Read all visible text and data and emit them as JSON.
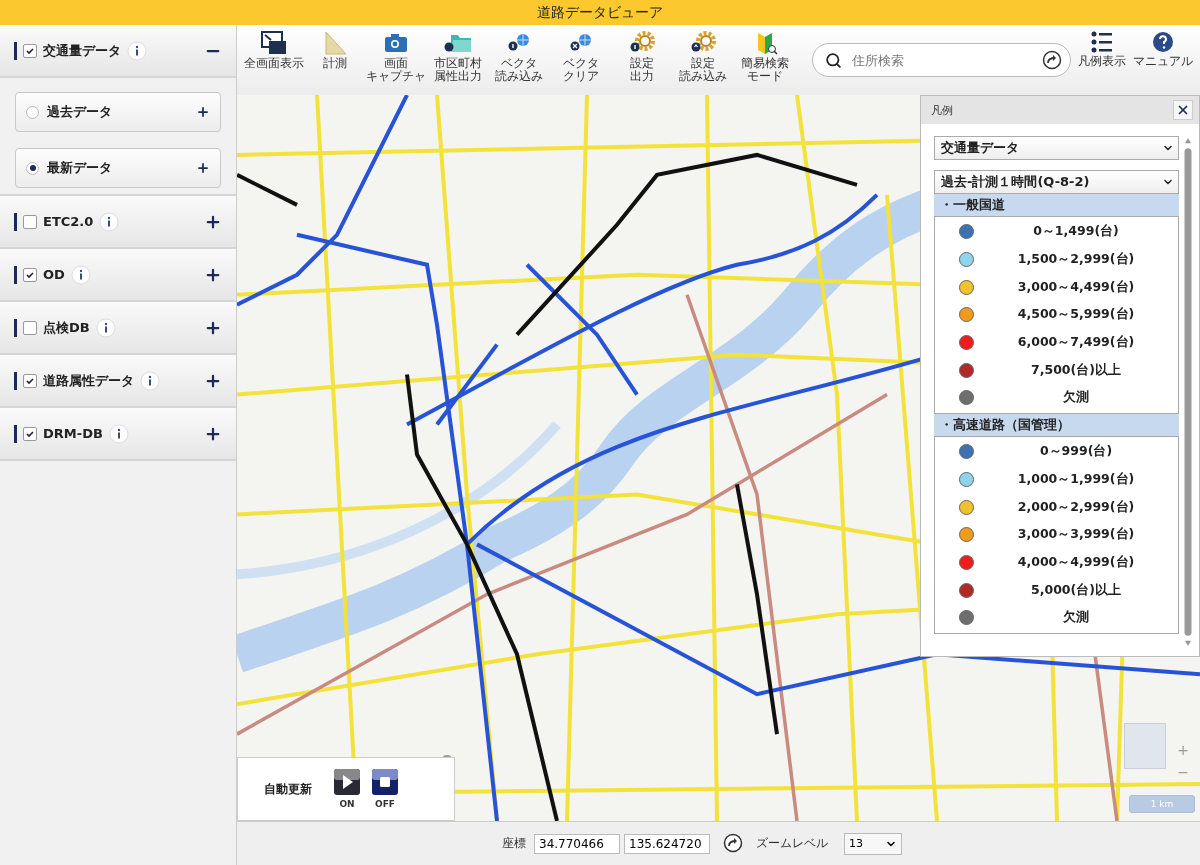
{
  "window": {
    "title": "道路データビューア"
  },
  "sidebar": {
    "layers": [
      {
        "label": "交通量データ",
        "checked": true,
        "expanded": true,
        "children": [
          {
            "label": "過去データ",
            "selected": false
          },
          {
            "label": "最新データ",
            "selected": true
          }
        ]
      },
      {
        "label": "ETC2.0",
        "checked": false,
        "expanded": false
      },
      {
        "label": "OD",
        "checked": true,
        "expanded": false
      },
      {
        "label": "点検DB",
        "checked": false,
        "expanded": false
      },
      {
        "label": "道路属性データ",
        "checked": true,
        "expanded": false
      },
      {
        "label": "DRM-DB",
        "checked": true,
        "expanded": false
      }
    ]
  },
  "toolbar": {
    "tools": [
      {
        "kind": "fullscreen",
        "lines": [
          "全画面表示"
        ]
      },
      {
        "kind": "ruler",
        "lines": [
          "計測"
        ]
      },
      {
        "kind": "camera",
        "lines": [
          "画面",
          "キャプチャ"
        ]
      },
      {
        "kind": "folder",
        "lines": [
          "市区町村",
          "属性出力"
        ]
      },
      {
        "kind": "vector-load",
        "lines": [
          "ベクタ",
          "読み込み"
        ]
      },
      {
        "kind": "vector-clear",
        "lines": [
          "ベクタ",
          "クリア"
        ]
      },
      {
        "kind": "gear-out",
        "lines": [
          "設定",
          "出力"
        ]
      },
      {
        "kind": "gear-in",
        "lines": [
          "設定",
          "読み込み"
        ]
      },
      {
        "kind": "beginner",
        "lines": [
          "簡易検索",
          "モード"
        ]
      }
    ],
    "search": {
      "placeholder": "住所検索"
    },
    "right_tools": [
      {
        "kind": "list",
        "label": "凡例表示"
      },
      {
        "kind": "help",
        "label": "マニュアル"
      }
    ]
  },
  "legend": {
    "title": "凡例",
    "selects": [
      "交通量データ",
      "過去-計測１時間(Q-8-2)"
    ],
    "groups": [
      {
        "title": "・一般国道",
        "items": [
          {
            "label": "0～1,499(台)",
            "color": "#3b72b4"
          },
          {
            "label": "1,500～2,999(台)",
            "color": "#8ed4ea"
          },
          {
            "label": "3,000～4,499(台)",
            "color": "#f2c22c"
          },
          {
            "label": "4,500～5,999(台)",
            "color": "#f09a1e"
          },
          {
            "label": "6,000～7,499(台)",
            "color": "#f01c1c"
          },
          {
            "label": "7,500(台)以上",
            "color": "#b02828"
          },
          {
            "label": "欠測",
            "color": "#6e6e6e"
          }
        ]
      },
      {
        "title": "・高速道路（国管理）",
        "items": [
          {
            "label": "0～999(台)",
            "color": "#3b72b4"
          },
          {
            "label": "1,000～1,999(台)",
            "color": "#8ed4ea"
          },
          {
            "label": "2,000～2,999(台)",
            "color": "#f2c22c"
          },
          {
            "label": "3,000～3,999(台)",
            "color": "#f09a1e"
          },
          {
            "label": "4,000～4,999(台)",
            "color": "#f01c1c"
          },
          {
            "label": "5,000(台)以上",
            "color": "#b02828"
          },
          {
            "label": "欠測",
            "color": "#6e6e6e"
          }
        ]
      }
    ]
  },
  "auto_update": {
    "label": "自動更新",
    "buttons": [
      {
        "kind": "play",
        "label": "ON"
      },
      {
        "kind": "stop",
        "label": "OFF"
      }
    ]
  },
  "map_controls": {
    "zoom_in": "+",
    "zoom_out": "−",
    "scale": "1 km"
  },
  "status_bar": {
    "coord_label": "座標",
    "lat": "34.770466",
    "lon": "135.624720",
    "zoom_label": "ズームレベル",
    "zoom": "13"
  }
}
